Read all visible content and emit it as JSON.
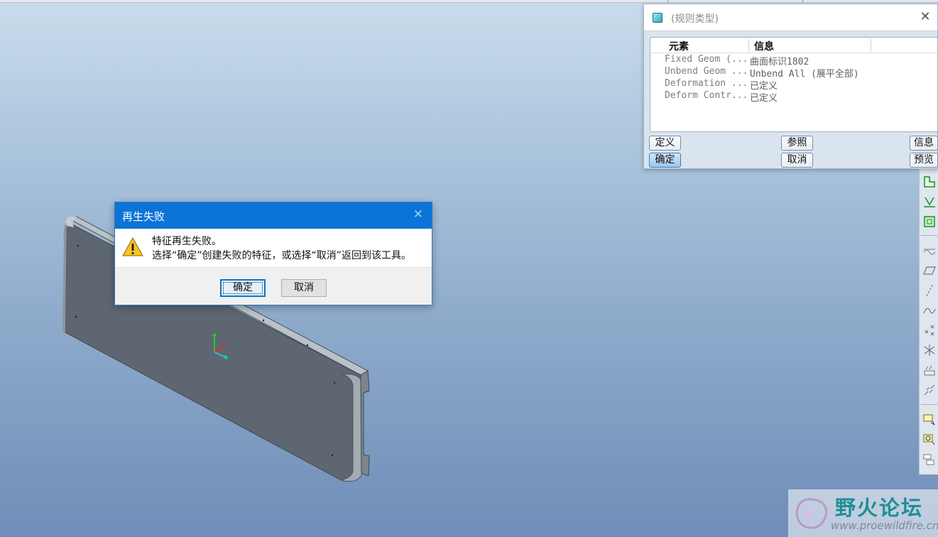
{
  "rule_dialog": {
    "title": "(规则类型)",
    "columns": [
      "元素",
      "信息"
    ],
    "rows": [
      {
        "element": "Fixed Geom (...",
        "info": "曲面标识1802"
      },
      {
        "element": "Unbend Geom ...",
        "info": "Unbend All (展平全部)"
      },
      {
        "element": "Deformation ...",
        "info": "已定义"
      },
      {
        "element": "Deform Contr...",
        "info": "已定义"
      }
    ],
    "buttons": {
      "define": "定义",
      "refs": "参照",
      "info": "信息",
      "ok": "确定",
      "cancel": "取消",
      "preview": "预览"
    }
  },
  "error_dialog": {
    "title": "再生失败",
    "line1": "特征再生失败。",
    "line2": "选择“确定”创建失败的特征，或选择“取消”返回到该工具。",
    "ok": "确定",
    "cancel": "取消"
  },
  "watermark": {
    "logo_text": "野火论坛",
    "url": "www.proewildfire.cn"
  },
  "icons": {
    "toolbar": [
      "sketch-icon",
      "offset-icon",
      "boundary-icon",
      "pattern-icon",
      "plane-icon",
      "axis-icon",
      "curve-icon",
      "point-icon",
      "csys-icon",
      "analysis-icon",
      "link-icon",
      "note-icon",
      "annotation-icon",
      "stack-icon"
    ]
  },
  "colors": {
    "title_blue": "#0b74d6",
    "model_gray": "#5f6872"
  }
}
